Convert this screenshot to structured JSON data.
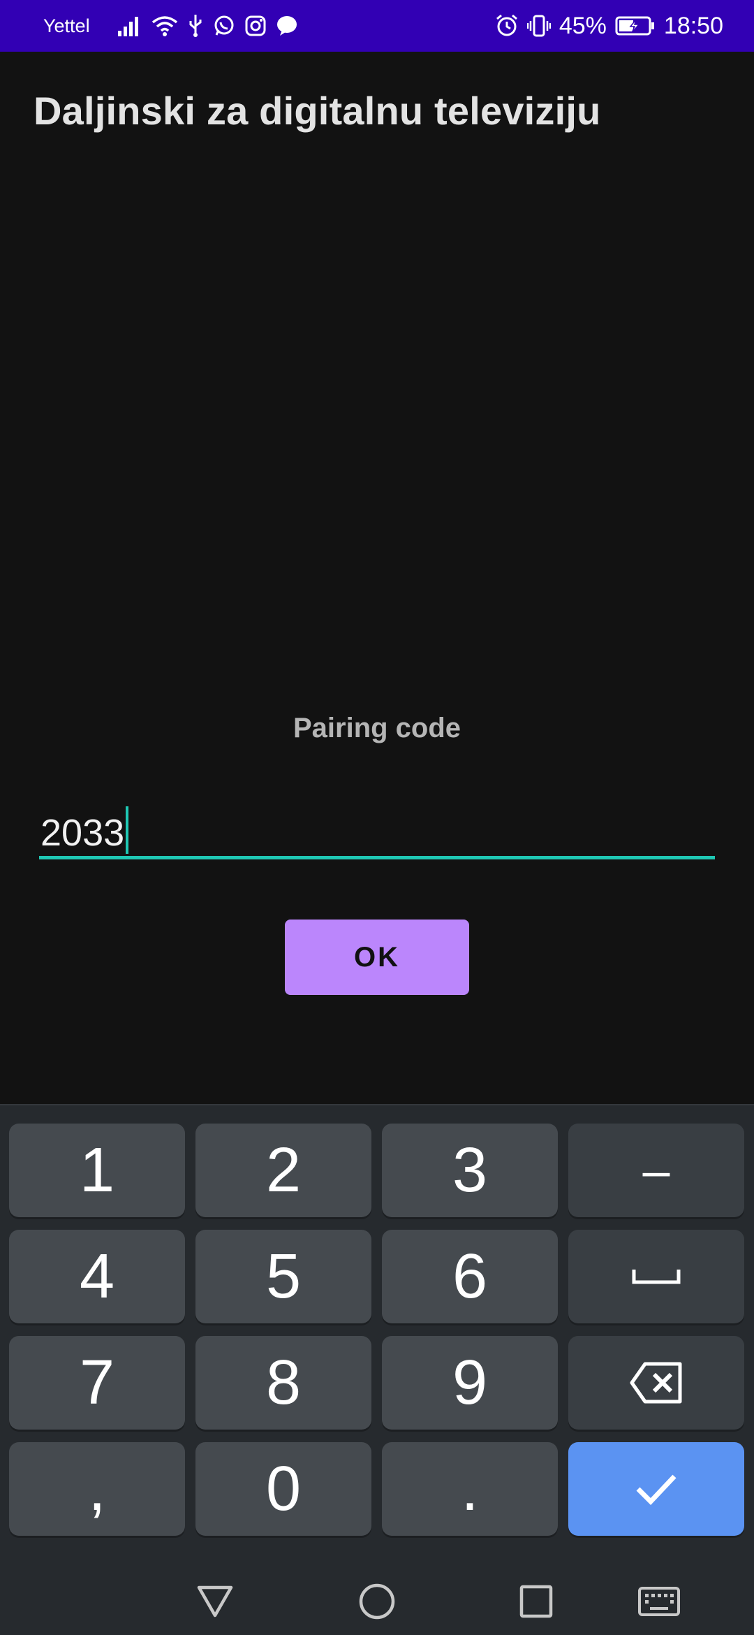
{
  "status_bar": {
    "carrier": "Yettel",
    "battery_percent": "45%",
    "time": "18:50",
    "left_icons": [
      "signal-icon",
      "wifi-icon",
      "usb-icon",
      "whatsapp-icon",
      "instagram-icon",
      "messenger-icon"
    ],
    "right_icons": [
      "alarm-icon",
      "vibrate-icon",
      "battery-icon"
    ]
  },
  "app": {
    "title": "Daljinski za digitalnu televiziju"
  },
  "pairing": {
    "label": "Pairing code",
    "code_value": "2033",
    "ok_label": "OK",
    "accent_color": "#1fc8b4",
    "button_color": "#bb86fc"
  },
  "keyboard": {
    "keys": {
      "k1": "1",
      "k2": "2",
      "k3": "3",
      "minus": "–",
      "k4": "4",
      "k5": "5",
      "k6": "6",
      "k7": "7",
      "k8": "8",
      "k9": "9",
      "comma": ",",
      "k0": "0",
      "period": "."
    },
    "special_icons": [
      "space-icon",
      "backspace-icon",
      "checkmark-icon"
    ],
    "enter_color": "#5b93f2"
  },
  "nav_bar": {
    "icons": [
      "back-icon",
      "home-icon",
      "recents-icon",
      "keyboard-icon"
    ]
  }
}
